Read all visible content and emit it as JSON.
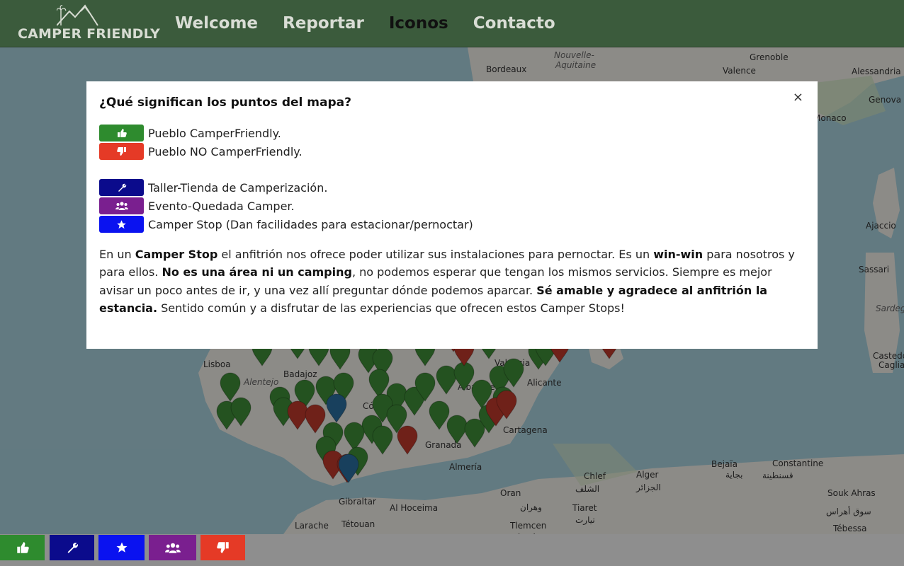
{
  "header": {
    "logo_text": "CAMPER FRIENDLY",
    "nav": [
      "Welcome",
      "Reportar",
      "Iconos",
      "Contacto"
    ],
    "active": "Iconos"
  },
  "map_labels": [
    {
      "text": "Bordeaux"
    },
    {
      "text": "Nouvelle-"
    },
    {
      "text": "Aquitaine"
    },
    {
      "text": "Grenoble"
    },
    {
      "text": "Valence"
    },
    {
      "text": "Alessandria"
    },
    {
      "text": "Genova"
    },
    {
      "text": "Monaco"
    },
    {
      "text": "Ajaccio"
    },
    {
      "text": "Sassari"
    },
    {
      "text": "Sardegn"
    },
    {
      "text": "Castedd"
    },
    {
      "text": "Cagliar"
    },
    {
      "text": "Lisboa"
    },
    {
      "text": "Alentejo"
    },
    {
      "text": "Badajoz"
    },
    {
      "text": "Valencia"
    },
    {
      "text": "Albacete"
    },
    {
      "text": "Alicante"
    },
    {
      "text": "Córdoba"
    },
    {
      "text": "Cartagena"
    },
    {
      "text": "Granada"
    },
    {
      "text": "Almería"
    },
    {
      "text": "Gibraltar"
    },
    {
      "text": "Al Hoceima"
    },
    {
      "text": "Larache"
    },
    {
      "text": "Tétouan"
    },
    {
      "text": "Oran"
    },
    {
      "text": "وهران"
    },
    {
      "text": "Chlef"
    },
    {
      "text": "الشلف"
    },
    {
      "text": "Alger"
    },
    {
      "text": "الجزائر"
    },
    {
      "text": "Bejaïa"
    },
    {
      "text": "بجاية"
    },
    {
      "text": "Constantine"
    },
    {
      "text": "قسنطينة"
    },
    {
      "text": "Tiaret"
    },
    {
      "text": "تيارت"
    },
    {
      "text": "Tlemcen"
    },
    {
      "text": "تلمسان"
    },
    {
      "text": "Souk Ahras"
    },
    {
      "text": "سوق أهراس"
    },
    {
      "text": "Tébessa"
    }
  ],
  "modal": {
    "title": "¿Qué significan los puntos del mapa?",
    "close": "×",
    "legend": [
      {
        "label": "Pueblo CamperFriendly.",
        "color": "#2e8b2e",
        "icon": "thumbs-up-icon"
      },
      {
        "label": "Pueblo NO CamperFriendly.",
        "color": "#e53a26",
        "icon": "thumbs-down-icon"
      },
      {
        "label": "Taller-Tienda de Camperización.",
        "color": "#0b0b8c",
        "icon": "wrench-icon"
      },
      {
        "label": "Evento-Quedada Camper.",
        "color": "#7a1f8f",
        "icon": "users-icon"
      },
      {
        "label": "Camper Stop (Dan facilidades para estacionar/pernoctar)",
        "color": "#0a12f0",
        "icon": "star-icon"
      }
    ],
    "paragraph": {
      "p1": "En un ",
      "b1": "Camper Stop",
      "p2": " el anfitrión nos ofrece poder utilizar sus instalaciones para pernoctar. Es un ",
      "b2": "win-win",
      "p3": " para nosotros y para ellos. ",
      "b3": "No es una área ni un camping",
      "p4": ", no podemos esperar que tengan los mismos servicios. Siempre es mejor avisar un poco antes de ir, y una vez allí preguntar dónde podemos aparcar. ",
      "b4": "Sé amable y agradece al anfitrión la estancia.",
      "p5": " Sentido común y a disfrutar de las experiencias que ofrecen estos Camper Stops!"
    }
  },
  "bottom_buttons": [
    {
      "name": "thumbs-up",
      "color": "#2e8b2e"
    },
    {
      "name": "wrench",
      "color": "#0b0b8c"
    },
    {
      "name": "star",
      "color": "#0a12f0"
    },
    {
      "name": "users",
      "color": "#7a1f8f"
    },
    {
      "name": "thumbs-down",
      "color": "#e53a26"
    }
  ],
  "colors": {
    "header_bg": "#3b5b3c",
    "sea": "#aad3df",
    "land": "#f2efe9"
  }
}
